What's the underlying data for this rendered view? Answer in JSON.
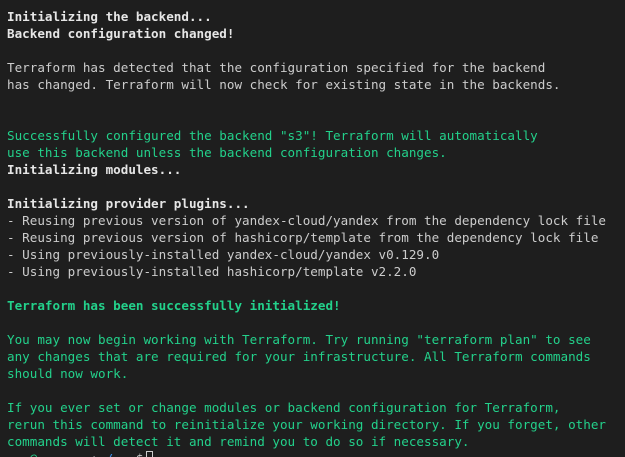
{
  "terminal": {
    "lines": [
      {
        "text": "Initializing the backend...",
        "style": "bold"
      },
      {
        "text": "Backend configuration changed!",
        "style": "bold"
      },
      {
        "text": "",
        "style": "blank"
      },
      {
        "text": "Terraform has detected that the configuration specified for the backend",
        "style": "normal"
      },
      {
        "text": "has changed. Terraform will now check for existing state in the backends.",
        "style": "normal"
      },
      {
        "text": "",
        "style": "blank"
      },
      {
        "text": "",
        "style": "blank"
      },
      {
        "text": "Successfully configured the backend \"s3\"! Terraform will automatically",
        "style": "green"
      },
      {
        "text": "use this backend unless the backend configuration changes.",
        "style": "green"
      },
      {
        "text": "Initializing modules...",
        "style": "bold"
      },
      {
        "text": "",
        "style": "blank"
      },
      {
        "text": "Initializing provider plugins...",
        "style": "bold"
      },
      {
        "text": "- Reusing previous version of yandex-cloud/yandex from the dependency lock file",
        "style": "normal"
      },
      {
        "text": "- Reusing previous version of hashicorp/template from the dependency lock file",
        "style": "normal"
      },
      {
        "text": "- Using previously-installed yandex-cloud/yandex v0.129.0",
        "style": "normal"
      },
      {
        "text": "- Using previously-installed hashicorp/template v2.2.0",
        "style": "normal"
      },
      {
        "text": "",
        "style": "blank"
      },
      {
        "text": "Terraform has been successfully initialized!",
        "style": "green-bold"
      },
      {
        "text": "",
        "style": "blank"
      },
      {
        "text": "You may now begin working with Terraform. Try running \"terraform plan\" to see",
        "style": "green"
      },
      {
        "text": "any changes that are required for your infrastructure. All Terraform commands",
        "style": "green"
      },
      {
        "text": "should now work.",
        "style": "green"
      },
      {
        "text": "",
        "style": "blank"
      },
      {
        "text": "If you ever set or change modules or backend configuration for Terraform,",
        "style": "green"
      },
      {
        "text": "rerun this command to reinitialize your working directory. If you forget, other",
        "style": "green"
      },
      {
        "text": "commands will detect it and remind you to do so if necessary.",
        "style": "green"
      }
    ],
    "prompt": {
      "user_host": "...@...-...",
      "path": "~/...",
      "symbol": "$"
    },
    "colors": {
      "background": "#1e1e1e",
      "foreground": "#cccccc",
      "green": "#23d18b",
      "blue": "#3b8eea"
    }
  }
}
